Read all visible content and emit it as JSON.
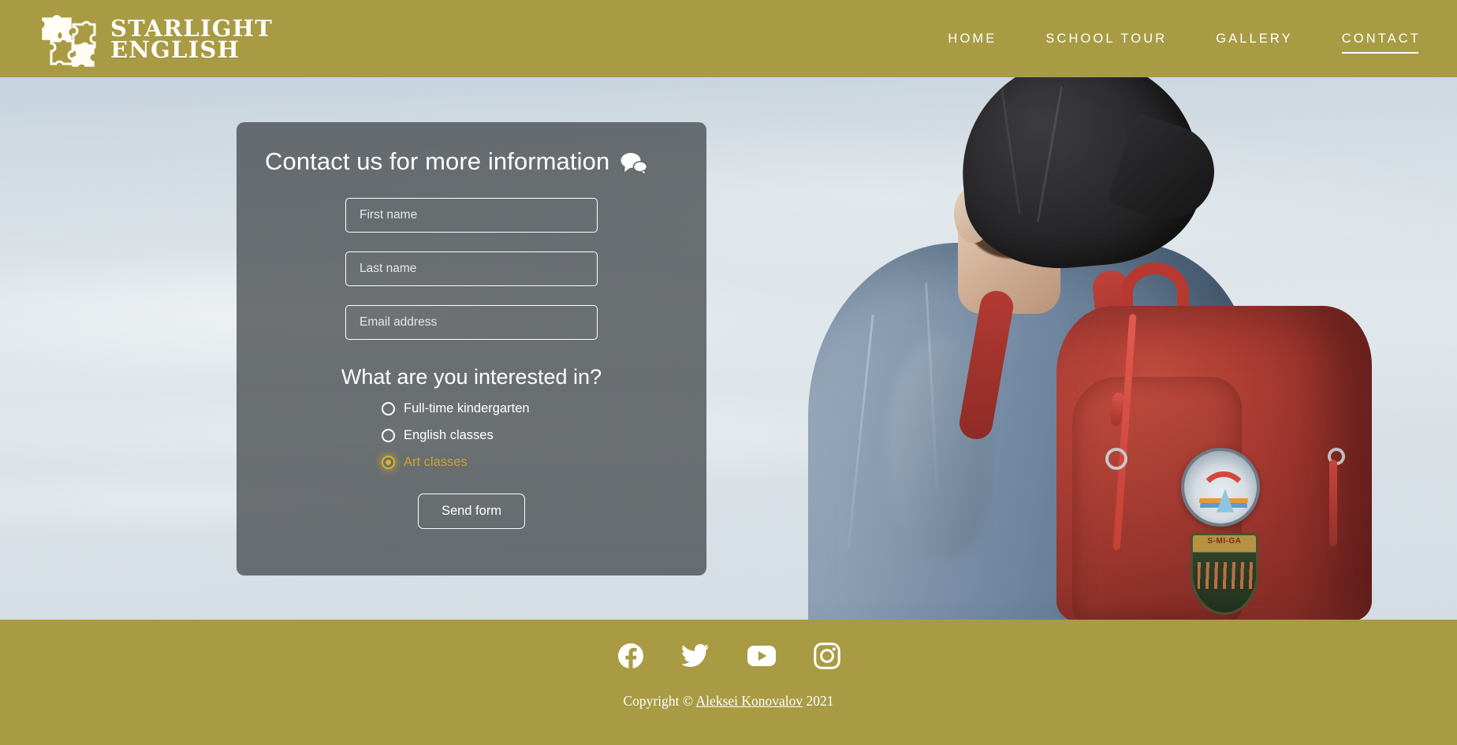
{
  "header": {
    "logo": {
      "icon": "puzzle-icon",
      "line1": "STARLIGHT",
      "line2": "ENGLISH"
    },
    "nav": [
      {
        "label": "HOME",
        "active": false
      },
      {
        "label": "SCHOOL TOUR",
        "active": false
      },
      {
        "label": "GALLERY",
        "active": false
      },
      {
        "label": "CONTACT",
        "active": true
      }
    ]
  },
  "contact_card": {
    "title": "Contact us for more information",
    "title_icon": "chat-bubbles-icon",
    "fields": [
      {
        "name": "first-name",
        "placeholder": "First name",
        "value": ""
      },
      {
        "name": "last-name",
        "placeholder": "Last name",
        "value": ""
      },
      {
        "name": "email-address",
        "placeholder": "Email address",
        "value": ""
      }
    ],
    "question": "What are you interested in?",
    "options": [
      {
        "label": "Full-time kindergarten",
        "selected": false
      },
      {
        "label": "English classes",
        "selected": false
      },
      {
        "label": "Art classes",
        "selected": true
      }
    ],
    "submit_label": "Send form"
  },
  "footer": {
    "socials": [
      {
        "name": "facebook-icon",
        "label": "Facebook"
      },
      {
        "name": "twitter-icon",
        "label": "Twitter"
      },
      {
        "name": "youtube-icon",
        "label": "YouTube"
      },
      {
        "name": "instagram-icon",
        "label": "Instagram"
      }
    ],
    "copyright_prefix": "Copyright ©",
    "copyright_author": "Aleksei Konovalov",
    "copyright_year": "2021"
  },
  "colors": {
    "brand_gold": "#A89B44",
    "accent_selected": "#D9B32A",
    "card_overlay": "rgba(60,64,66,.72)",
    "sky": "#D6E0E7",
    "text_on_brand": "#FFFFFF"
  },
  "hero": {
    "alt": "Person seen from behind wearing a black cap, denim jacket and a red backpack against a pale sky"
  }
}
